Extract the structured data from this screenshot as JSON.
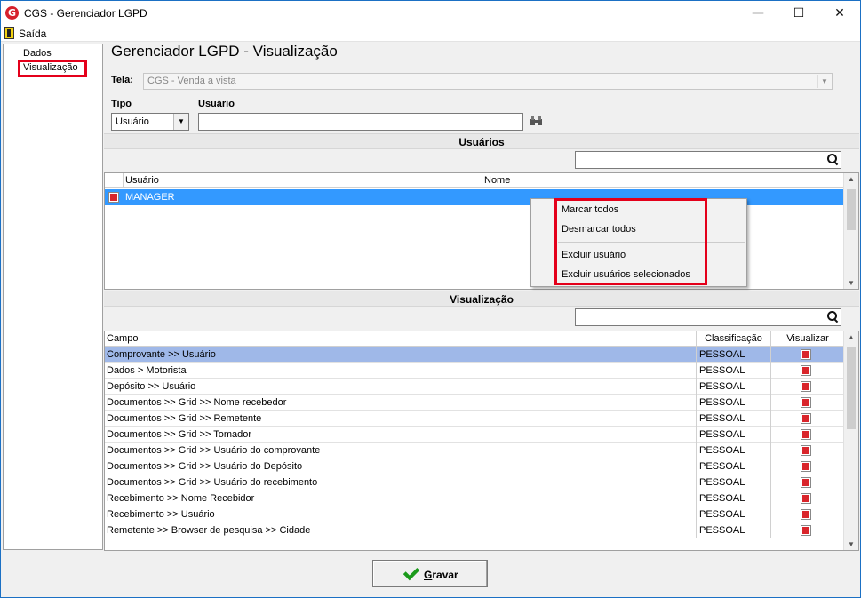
{
  "window": {
    "title": "CGS - Gerenciador LGPD",
    "logo_letter": "G",
    "minimize": "—",
    "maximize": "☐",
    "close": "✕"
  },
  "menu": {
    "exit_label": "Saída"
  },
  "nav": {
    "items": [
      {
        "label": "Dados"
      },
      {
        "label": "Visualização",
        "highlighted": true
      }
    ]
  },
  "page": {
    "title": "Gerenciador LGPD - Visualização"
  },
  "form": {
    "tela_label": "Tela:",
    "tela_value": "CGS - Venda a vista",
    "tipo_label": "Tipo",
    "tipo_value": "Usuário",
    "usuario_label": "Usuário",
    "usuario_value": ""
  },
  "users_section": {
    "title": "Usuários",
    "columns": [
      "Usuário",
      "Nome"
    ],
    "rows": [
      {
        "usuario": "MANAGER",
        "nome": "",
        "checked": true,
        "selected": true
      }
    ]
  },
  "context_menu": {
    "items": [
      "Marcar todos",
      "Desmarcar todos",
      "Excluir usuário",
      "Excluir usuários selecionados"
    ]
  },
  "vis_section": {
    "title": "Visualização",
    "columns": [
      "Campo",
      "Classificação",
      "Visualizar"
    ],
    "rows": [
      {
        "campo": "Comprovante >> Usuário",
        "classificacao": "PESSOAL",
        "visualizar": true,
        "selected": true
      },
      {
        "campo": "Dados > Motorista",
        "classificacao": "PESSOAL",
        "visualizar": true
      },
      {
        "campo": "Depósito >> Usuário",
        "classificacao": "PESSOAL",
        "visualizar": true
      },
      {
        "campo": "Documentos >> Grid >> Nome recebedor",
        "classificacao": "PESSOAL",
        "visualizar": true
      },
      {
        "campo": "Documentos >> Grid >> Remetente",
        "classificacao": "PESSOAL",
        "visualizar": true
      },
      {
        "campo": "Documentos >> Grid >> Tomador",
        "classificacao": "PESSOAL",
        "visualizar": true
      },
      {
        "campo": "Documentos >> Grid >> Usuário do comprovante",
        "classificacao": "PESSOAL",
        "visualizar": true
      },
      {
        "campo": "Documentos >> Grid >> Usuário do Depósito",
        "classificacao": "PESSOAL",
        "visualizar": true
      },
      {
        "campo": "Documentos >> Grid >> Usuário do recebimento",
        "classificacao": "PESSOAL",
        "visualizar": true
      },
      {
        "campo": "Recebimento >> Nome Recebidor",
        "classificacao": "PESSOAL",
        "visualizar": true
      },
      {
        "campo": "Recebimento >> Usuário",
        "classificacao": "PESSOAL",
        "visualizar": true
      },
      {
        "campo": "Remetente >> Browser de pesquisa >> Cidade",
        "classificacao": "PESSOAL",
        "visualizar": true
      }
    ]
  },
  "footer": {
    "save_label": "Gravar"
  },
  "colors": {
    "accent": "#3399ff",
    "highlight_border": "#e4001b",
    "selected_row": "#9fb8e8",
    "check_red": "#d9252b"
  }
}
